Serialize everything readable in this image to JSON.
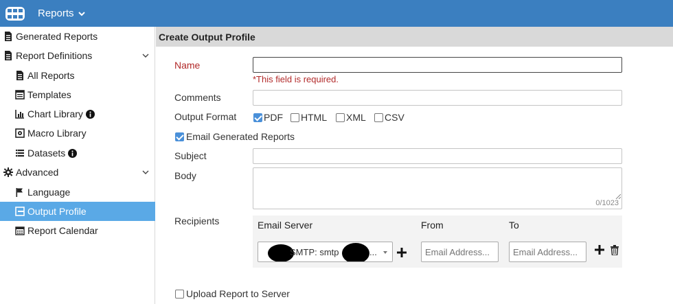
{
  "topbar": {
    "app_icon": "fabric-grid-icon",
    "menu_label": "Reports",
    "color": "#3b7fc0"
  },
  "sidebar": {
    "items": [
      {
        "label": "Generated Reports",
        "icon": "document-icon",
        "level": 1
      },
      {
        "label": "Report Definitions",
        "icon": "document-icon",
        "level": 1,
        "expandable": true
      },
      {
        "label": "All Reports",
        "icon": "document-icon",
        "level": 2
      },
      {
        "label": "Templates",
        "icon": "template-icon",
        "level": 2
      },
      {
        "label": "Chart Library",
        "icon": "chart-icon",
        "level": 2,
        "info": true
      },
      {
        "label": "Macro Library",
        "icon": "macro-icon",
        "level": 2
      },
      {
        "label": "Datasets",
        "icon": "dataset-icon",
        "level": 2,
        "info": true
      },
      {
        "label": "Advanced",
        "icon": "gear-icon",
        "level": 1,
        "expandable": true
      },
      {
        "label": "Language",
        "icon": "flag-icon",
        "level": 2
      },
      {
        "label": "Output Profile",
        "icon": "output-icon",
        "level": 2,
        "active": true
      },
      {
        "label": "Report Calendar",
        "icon": "calendar-icon",
        "level": 2
      }
    ],
    "active_color": "#5aa9e6"
  },
  "main": {
    "title": "Create Output Profile",
    "form": {
      "name_label": "Name",
      "name_value": "",
      "name_error": "*This field is required.",
      "comments_label": "Comments",
      "comments_value": "",
      "output_format_label": "Output Format",
      "formats": [
        {
          "label": "PDF",
          "checked": true
        },
        {
          "label": "HTML",
          "checked": false
        },
        {
          "label": "XML",
          "checked": false
        },
        {
          "label": "CSV",
          "checked": false
        }
      ],
      "email_generated_label": "Email Generated Reports",
      "email_generated_checked": true,
      "subject_label": "Subject",
      "subject_value": "",
      "body_label": "Body",
      "body_value": "",
      "body_counter": "0/1023",
      "recipients_label": "Recipients",
      "recipients": {
        "col_email_server": "Email Server",
        "col_from": "From",
        "col_to": "To",
        "email_server_value": "SMTP: smtp",
        "email_server_ellipsis": "...",
        "from_placeholder": "Email Address...",
        "to_placeholder": "Email Address..."
      },
      "upload_label": "Upload Report to Server",
      "upload_checked": false
    }
  }
}
